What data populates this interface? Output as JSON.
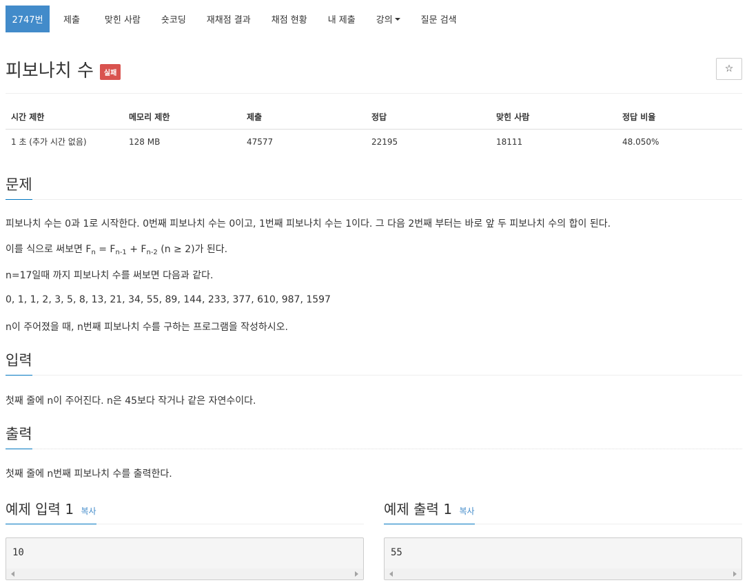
{
  "nav": {
    "items": [
      "2747번",
      "제출",
      "맞힌 사람",
      "숏코딩",
      "재채점 결과",
      "채점 현황",
      "내 제출",
      "강의",
      "질문 검색"
    ]
  },
  "problem": {
    "title": "피보나치 수",
    "status_badge": "실패",
    "star": "☆"
  },
  "stats": {
    "headers": [
      "시간 제한",
      "메모리 제한",
      "제출",
      "정답",
      "맞힌 사람",
      "정답 비율"
    ],
    "values": [
      "1 초 (추가 시간 없음)",
      "128 MB",
      "47577",
      "22195",
      "18111",
      "48.050%"
    ]
  },
  "sections": {
    "problem_heading": "문제",
    "p1": "피보나치 수는 0과 1로 시작한다. 0번째 피보나치 수는 0이고, 1번째 피보나치 수는 1이다. 그 다음 2번째 부터는 바로 앞 두 피보나치 수의 합이 된다.",
    "p2": {
      "prefix": "이를 식으로 써보면 F",
      "sub_n": "n",
      "eq": " = F",
      "sub_n1": "n-1",
      "plus": " + F",
      "sub_n2": "n-2",
      "suffix": " (n ≥ 2)가 된다."
    },
    "p3": "n=17일때 까지 피보나치 수를 써보면 다음과 같다.",
    "p4": "0, 1, 1, 2, 3, 5, 8, 13, 21, 34, 55, 89, 144, 233, 377, 610, 987, 1597",
    "p5": "n이 주어졌을 때, n번째 피보나치 수를 구하는 프로그램을 작성하시오.",
    "input_heading": "입력",
    "input_text": "첫째 줄에 n이 주어진다. n은 45보다 작거나 같은 자연수이다.",
    "output_heading": "출력",
    "output_text": "첫째 줄에 n번째 피보나치 수를 출력한다."
  },
  "samples": {
    "input_title": "예제 입력 1",
    "output_title": "예제 출력 1",
    "copy_label": "복사",
    "input_value": "10",
    "output_value": "55"
  },
  "colors": {
    "nav_active": "#428bca",
    "badge": "#d9534f",
    "heading_underline": "#0076c0"
  }
}
